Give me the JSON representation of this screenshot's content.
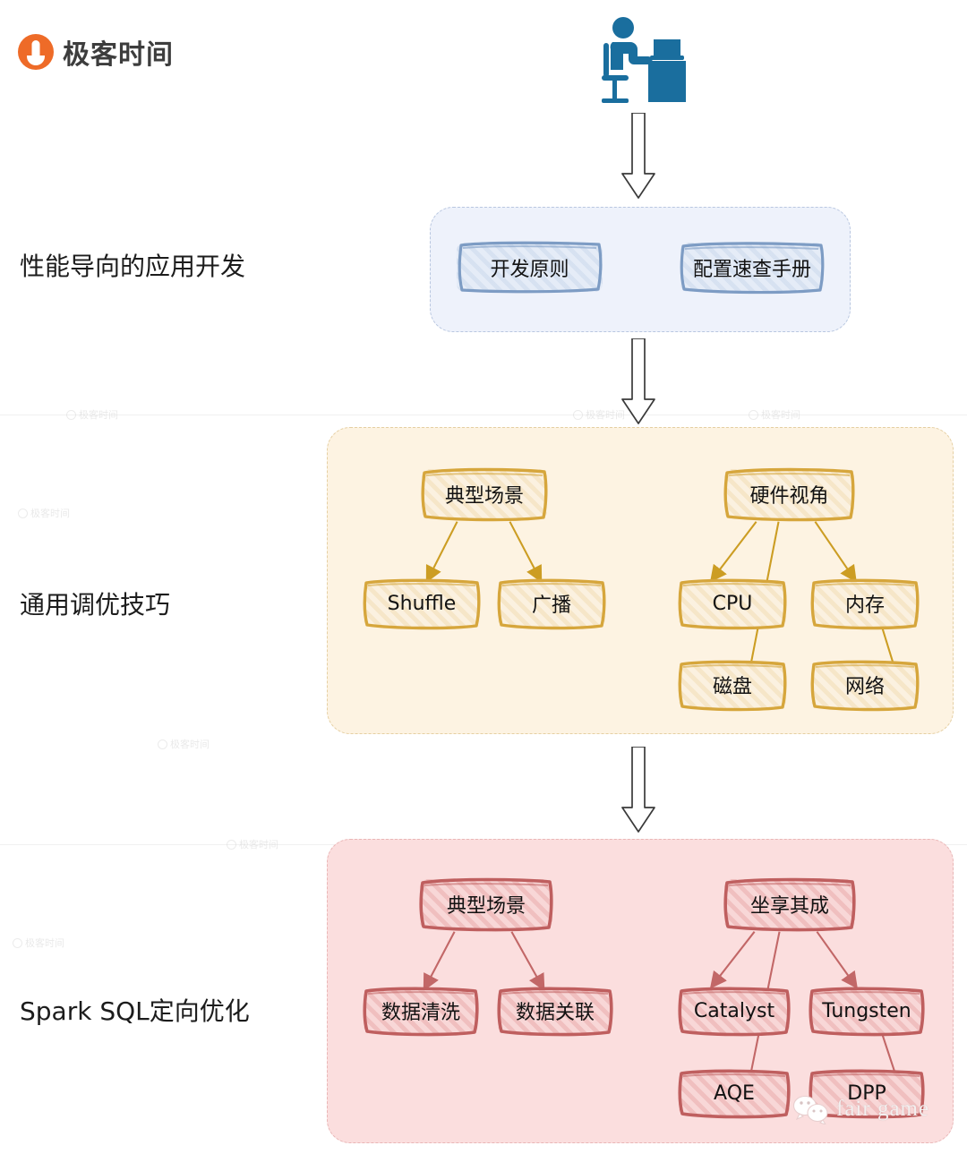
{
  "brand": {
    "name": "极客时间",
    "logo_icon": "geektime-lightbulb-icon",
    "accent": "#ee6b28"
  },
  "header_icon": {
    "name": "person-at-desk-icon",
    "color": "#1a6e9e"
  },
  "sections": [
    {
      "id": "dev",
      "label": "性能导向的应用开发",
      "panel_bg": "#eef2fb",
      "panel_border": "#b9c7e0",
      "theme": "blue",
      "nodes": [
        "开发原则",
        "配置速查手册"
      ]
    },
    {
      "id": "tune",
      "label": "通用调优技巧",
      "panel_bg": "#fdf3e2",
      "panel_border": "#e5cfa2",
      "theme": "amber",
      "nodes": [
        "典型场景",
        "Shuffle",
        "广播",
        "硬件视角",
        "CPU",
        "内存",
        "磁盘",
        "网络"
      ]
    },
    {
      "id": "sql",
      "label": "Spark SQL定向优化",
      "panel_bg": "#fbdede",
      "panel_border": "#e9b6b6",
      "theme": "red",
      "nodes": [
        "典型场景",
        "数据清洗",
        "数据关联",
        "坐享其成",
        "Catalyst",
        "Tungsten",
        "AQE",
        "DPP"
      ]
    }
  ],
  "nodes": {
    "dev_principle": "开发原则",
    "dev_config": "配置速查手册",
    "tune_scene": "典型场景",
    "tune_shuffle": "Shuffle",
    "tune_broadcast": "广播",
    "tune_hardware": "硬件视角",
    "tune_cpu": "CPU",
    "tune_memory": "内存",
    "tune_disk": "磁盘",
    "tune_network": "网络",
    "sql_scene": "典型场景",
    "sql_clean": "数据清洗",
    "sql_join": "数据关联",
    "sql_free": "坐享其成",
    "sql_catalyst": "Catalyst",
    "sql_tungsten": "Tungsten",
    "sql_aqe": "AQE",
    "sql_dpp": "DPP"
  },
  "flow_arrows": [
    {
      "name": "arrow-person-to-dev",
      "from": "person-at-desk-icon",
      "to": "性能导向的应用开发"
    },
    {
      "name": "arrow-dev-to-tune",
      "from": "性能导向的应用开发",
      "to": "通用调优技巧"
    },
    {
      "name": "arrow-tune-to-sql",
      "from": "通用调优技巧",
      "to": "Spark SQL定向优化"
    }
  ],
  "watermark": {
    "tile_text": "极客时间",
    "corner_text": "fair game",
    "corner_icon": "wechat-icon"
  }
}
